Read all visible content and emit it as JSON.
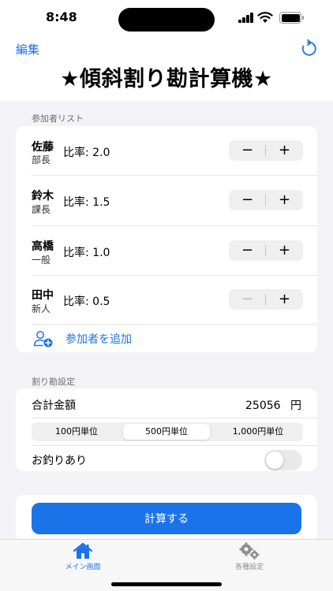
{
  "status": {
    "time": "8:48"
  },
  "nav": {
    "edit_label": "編集",
    "reset_icon": "arrow-counterclockwise-icon"
  },
  "title": "★傾斜割り勘計算機★",
  "participants_section": {
    "header": "参加者リスト",
    "participants": [
      {
        "name": "佐藤",
        "role": "部長",
        "ratio": "比率: 2.0",
        "decrement": "−",
        "increment": "+"
      },
      {
        "name": "鈴木",
        "role": "課長",
        "ratio": "比率: 1.5",
        "decrement": "−",
        "increment": "+"
      },
      {
        "name": "高橋",
        "role": "一般",
        "ratio": "比率: 1.0",
        "decrement": "−",
        "increment": "+"
      },
      {
        "name": "田中",
        "role": "新人",
        "ratio": "比率: 0.5",
        "decrement": "−",
        "increment": "+"
      }
    ],
    "add_label": "参加者を追加"
  },
  "settings_section": {
    "header": "割り勘設定",
    "total_label": "合計金額",
    "total_value": "25056",
    "total_unit": "円",
    "units": [
      "100円単位",
      "500円単位",
      "1,000円単位"
    ],
    "selected_unit": "500円単位",
    "change_label": "お釣りあり",
    "change_enabled": false
  },
  "calc_button_label": "計算する",
  "tabs": [
    {
      "label": "メイン画面",
      "icon": "house-icon",
      "active": true
    },
    {
      "label": "各種設定",
      "icon": "gears-icon",
      "active": false
    }
  ],
  "colors": {
    "accent": "#1a73e8",
    "background": "#f2f2f7",
    "stepper": "#efeff0"
  }
}
